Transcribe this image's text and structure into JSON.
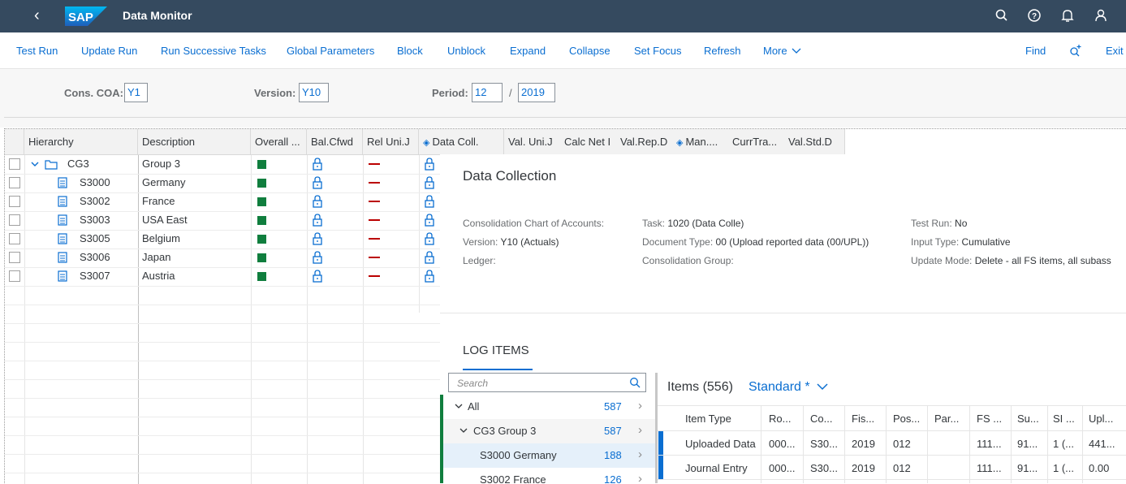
{
  "shell": {
    "title": "Data Monitor",
    "logo": "SAP"
  },
  "toolbar": {
    "buttons": [
      "Test Run",
      "Update Run",
      "Run Successive Tasks",
      "Global Parameters",
      "Block",
      "Unblock",
      "Expand",
      "Collapse",
      "Set Focus",
      "Refresh",
      "More"
    ],
    "find": "Find",
    "exit": "Exit"
  },
  "filters": {
    "coa_label": "Cons. COA:",
    "coa_value": "Y1",
    "version_label": "Version:",
    "version_value": "Y10",
    "period_label": "Period:",
    "period_value": "12",
    "period_sep": "/",
    "year_value": "2019"
  },
  "grid": {
    "columns": [
      "Hierarchy",
      "Description",
      "Overall ...",
      "Bal.Cfwd",
      "Rel Uni.J",
      "Data Coll.",
      "Val. Uni.J",
      "Calc Net I",
      "Val.Rep.D",
      "Man....",
      "CurrTra...",
      "Val.Std.D"
    ],
    "rows": [
      {
        "id": "CG3",
        "desc": "Group 3"
      },
      {
        "id": "S3000",
        "desc": "Germany"
      },
      {
        "id": "S3002",
        "desc": "France"
      },
      {
        "id": "S3003",
        "desc": "USA East"
      },
      {
        "id": "S3005",
        "desc": "Belgium"
      },
      {
        "id": "S3006",
        "desc": "Japan"
      },
      {
        "id": "S3007",
        "desc": "Austria"
      }
    ],
    "status_colors": {
      "ok": "#107e3e",
      "error": "#bb0000"
    }
  },
  "detail": {
    "title": "Data Collection",
    "col1": [
      {
        "label": "Consolidation Chart of Accounts:",
        "value": ""
      },
      {
        "label": "Version:",
        "value": "Y10 (Actuals)"
      },
      {
        "label": "Ledger:",
        "value": ""
      }
    ],
    "col2": [
      {
        "label": "Task:",
        "value": "1020 (Data Colle)"
      },
      {
        "label": "Document Type:",
        "value": "00 (Upload reported data (00/UPL))"
      },
      {
        "label": "Consolidation Group:",
        "value": ""
      }
    ],
    "col3": [
      {
        "label": "Test Run:",
        "value": "No"
      },
      {
        "label": "Input Type:",
        "value": "Cumulative"
      },
      {
        "label": "Update Mode:",
        "value": "Delete - all FS items, all subass"
      }
    ],
    "log_title": "LOG ITEMS",
    "search_placeholder": "Search",
    "tree": [
      {
        "label": "All",
        "count": "587"
      },
      {
        "label": "CG3 Group 3",
        "count": "587"
      },
      {
        "label": "S3000 Germany",
        "count": "188"
      },
      {
        "label": "S3002 France",
        "count": "126"
      }
    ],
    "items_title": "Items (556)",
    "variant": "Standard *",
    "item_columns": [
      "Item Type",
      "Ro...",
      "Co...",
      "Fis...",
      "Pos...",
      "Par...",
      "FS ...",
      "Su...",
      "SI ...",
      "Upl..."
    ],
    "item_rows": [
      [
        "Uploaded Data",
        "000...",
        "S30...",
        "2019",
        "012",
        "",
        "111...",
        "91...",
        "1 (...",
        "441..."
      ],
      [
        "Journal Entry",
        "000...",
        "S30...",
        "2019",
        "012",
        "",
        "111...",
        "91...",
        "1 (...",
        "0.00"
      ]
    ]
  }
}
